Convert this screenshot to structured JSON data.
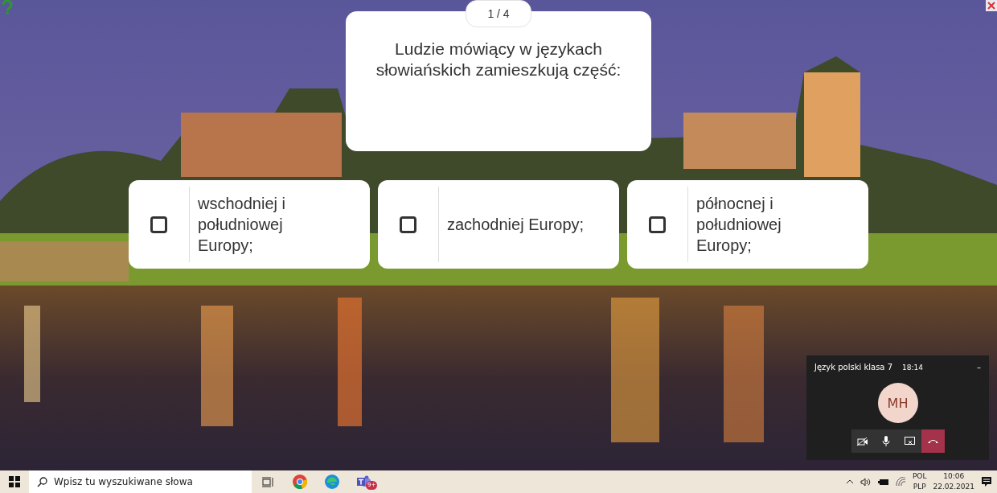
{
  "quiz": {
    "counter": "1 / 4",
    "question": "Ludzie mówiący w językach słowiańskich zamieszkują część:",
    "answers": [
      {
        "text": "wschodniej i południowej Europy;",
        "checked": false
      },
      {
        "text": "zachodniej Europy;",
        "checked": false
      },
      {
        "text": "północnej i południowej Europy;",
        "checked": false
      }
    ]
  },
  "call": {
    "title": "Język polski klasa 7",
    "duration": "18:14",
    "minimize": "–",
    "avatar": "MH"
  },
  "taskbar": {
    "search_placeholder": "Wpisz tu wyszukiwane słowa",
    "teams_badge": "9+",
    "language": "POL",
    "layout": "PLP",
    "time": "10:06",
    "date": "22.02.2021"
  }
}
